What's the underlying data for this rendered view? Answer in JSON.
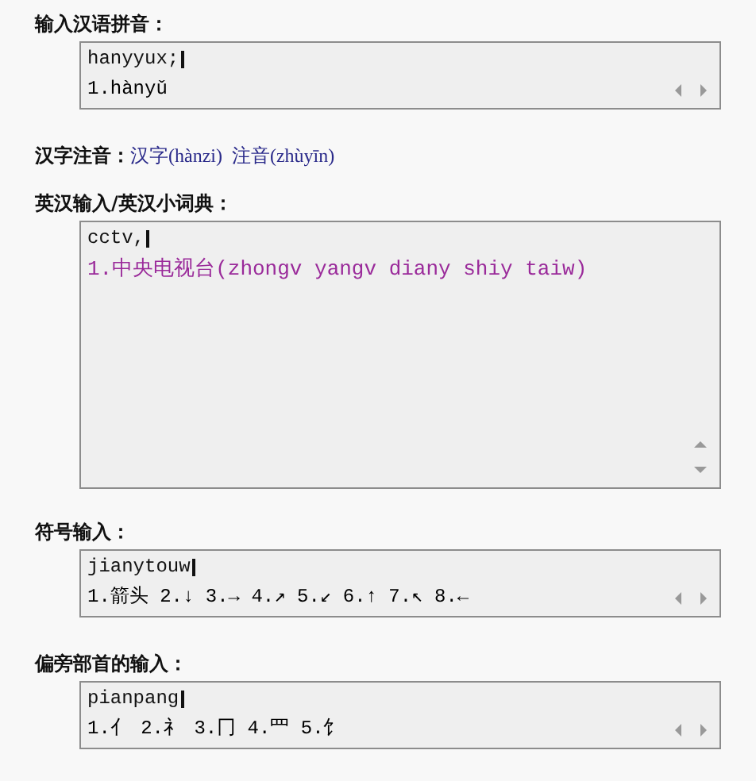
{
  "sections": [
    {
      "kind": "input",
      "label": "输入汉语拼音：",
      "input": "hanyyux;",
      "candidates": [
        {
          "text": "1.hànyǔ",
          "color": "#000000"
        }
      ]
    },
    {
      "kind": "annotation",
      "label": "汉字注音：",
      "links": [
        "汉字(hànzi)",
        "注音(zhùyīn)"
      ]
    },
    {
      "kind": "dictionary",
      "label": "英汉输入/英汉小词典：",
      "input": "cctv,",
      "candidates": [
        {
          "text": "1.中央电视台(zhongv yangv diany shiy taiw)",
          "color": "#9a2a9a"
        }
      ]
    },
    {
      "kind": "input",
      "label": "符号输入：",
      "input": "jianytouw",
      "candidates": [
        {
          "text": "1.箭头 2.↓ 3.→ 4.↗ 5.↙ 6.↑ 7.↖ 8.←",
          "color": "#000000"
        }
      ]
    },
    {
      "kind": "input",
      "label": "偏旁部首的输入：",
      "input": "pianpang",
      "candidates": [
        {
          "text": "1.亻 2.礻 3.冂 4.罒 5.饣",
          "color": "#000000"
        }
      ]
    }
  ]
}
